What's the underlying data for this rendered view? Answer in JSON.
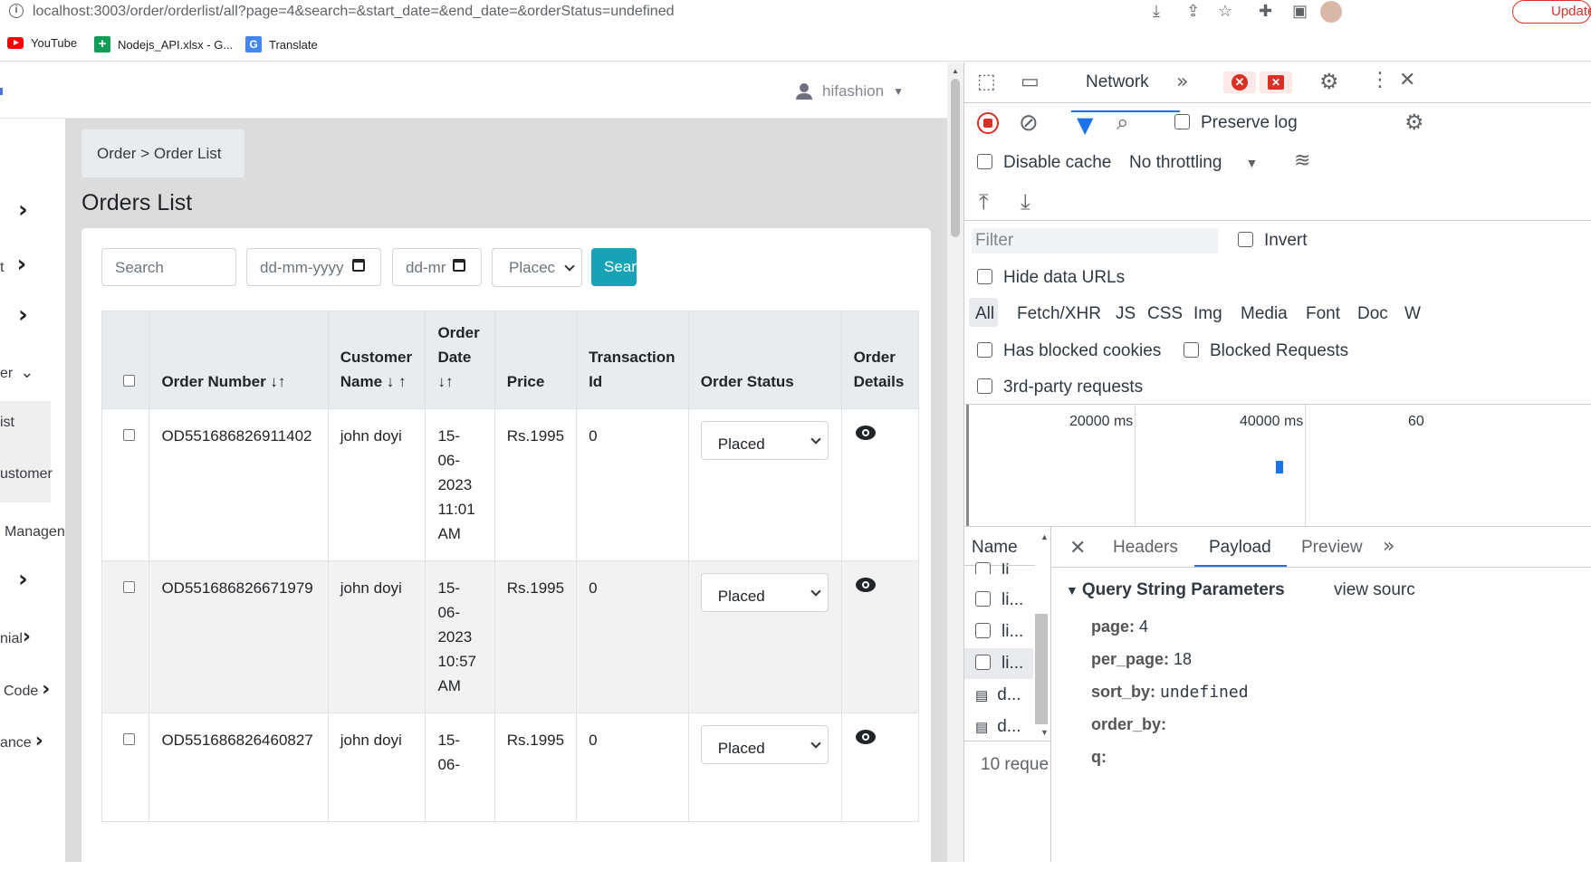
{
  "browser": {
    "url": "localhost:3003/order/orderlist/all?page=4&search=&start_date=&end_date=&orderStatus=undefined",
    "update_label": "Update",
    "bookmarks": [
      {
        "label": "YouTube"
      },
      {
        "label": "Nodejs_API.xlsx - G..."
      },
      {
        "label": "Translate"
      }
    ]
  },
  "header": {
    "username": "hifashion"
  },
  "sidebar": {
    "items": [
      {
        "label": ""
      },
      {
        "label": "t"
      },
      {
        "label": ""
      },
      {
        "label": "er"
      },
      {
        "label": "ist"
      },
      {
        "label": "ustomer"
      },
      {
        "label": "Managen"
      },
      {
        "label": ""
      },
      {
        "label": "nial"
      },
      {
        "label": "Code"
      },
      {
        "label": "ance"
      }
    ]
  },
  "breadcrumb": {
    "parent": "Order",
    "separator": ">",
    "current": "Order List"
  },
  "page_title": "Orders List",
  "filters": {
    "search_placeholder": "Search",
    "start_date_placeholder": "dd-mm-yyyy",
    "end_date_placeholder": "dd-mr",
    "status_value": "Placec",
    "search_button": "Sear"
  },
  "table": {
    "headers": {
      "order_number": "Order Number ↓↑",
      "customer_name": "Customer Name ↓ ↑",
      "order_date": "Order Date ↓↑",
      "price": "Price",
      "transaction_id": "Transaction Id",
      "order_status": "Order Status",
      "order_details": "Order Details"
    },
    "rows": [
      {
        "order_number": "OD551686826911402",
        "customer": "john doyi",
        "date": "15-\n06-\n2023\n11:01\nAM",
        "price": "Rs.1995",
        "txn": "0",
        "status": "Placed"
      },
      {
        "order_number": "OD551686826671979",
        "customer": "john doyi",
        "date": "15-\n06-\n2023\n10:57\nAM",
        "price": "Rs.1995",
        "txn": "0",
        "status": "Placed"
      },
      {
        "order_number": "OD551686826460827",
        "customer": "john doyi",
        "date": "15-\n06-",
        "price": "Rs.1995",
        "txn": "0",
        "status": "Placed"
      }
    ]
  },
  "devtools": {
    "active_panel": "Network",
    "preserve_log": "Preserve log",
    "disable_cache": "Disable cache",
    "throttling": "No throttling",
    "filter_placeholder": "Filter",
    "invert": "Invert",
    "hide_data_urls": "Hide data URLs",
    "types": [
      "All",
      "Fetch/XHR",
      "JS",
      "CSS",
      "Img",
      "Media",
      "Font",
      "Doc",
      "W"
    ],
    "has_blocked_cookies": "Has blocked cookies",
    "blocked_requests": "Blocked Requests",
    "third_party": "3rd-party requests",
    "timeline_ticks": [
      "20000 ms",
      "40000 ms",
      "60"
    ],
    "name_header": "Name",
    "requests": [
      "li...",
      "li...",
      "li...",
      "li...",
      "d...",
      "d..."
    ],
    "request_count": "10 reque",
    "detail_tabs": [
      "Headers",
      "Payload",
      "Preview"
    ],
    "active_detail_tab": "Payload",
    "section_title": "Query String Parameters",
    "view_source": "view sourc",
    "params": [
      {
        "key": "page:",
        "value": "4"
      },
      {
        "key": "per_page:",
        "value": "18"
      },
      {
        "key": "sort_by:",
        "value": "undefined"
      },
      {
        "key": "order_by:",
        "value": ""
      },
      {
        "key": "q:",
        "value": ""
      }
    ]
  }
}
